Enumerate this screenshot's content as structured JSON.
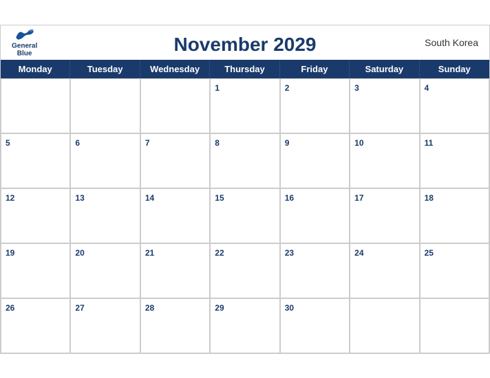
{
  "calendar": {
    "title": "November 2029",
    "country": "South Korea",
    "dayNames": [
      "Monday",
      "Tuesday",
      "Wednesday",
      "Thursday",
      "Friday",
      "Saturday",
      "Sunday"
    ],
    "weeks": [
      [
        {
          "date": "",
          "empty": true
        },
        {
          "date": "",
          "empty": true
        },
        {
          "date": "",
          "empty": true
        },
        {
          "date": "1",
          "empty": false
        },
        {
          "date": "2",
          "empty": false
        },
        {
          "date": "3",
          "empty": false
        },
        {
          "date": "4",
          "empty": false
        }
      ],
      [
        {
          "date": "5",
          "empty": false
        },
        {
          "date": "6",
          "empty": false
        },
        {
          "date": "7",
          "empty": false
        },
        {
          "date": "8",
          "empty": false
        },
        {
          "date": "9",
          "empty": false
        },
        {
          "date": "10",
          "empty": false
        },
        {
          "date": "11",
          "empty": false
        }
      ],
      [
        {
          "date": "12",
          "empty": false
        },
        {
          "date": "13",
          "empty": false
        },
        {
          "date": "14",
          "empty": false
        },
        {
          "date": "15",
          "empty": false
        },
        {
          "date": "16",
          "empty": false
        },
        {
          "date": "17",
          "empty": false
        },
        {
          "date": "18",
          "empty": false
        }
      ],
      [
        {
          "date": "19",
          "empty": false
        },
        {
          "date": "20",
          "empty": false
        },
        {
          "date": "21",
          "empty": false
        },
        {
          "date": "22",
          "empty": false
        },
        {
          "date": "23",
          "empty": false
        },
        {
          "date": "24",
          "empty": false
        },
        {
          "date": "25",
          "empty": false
        }
      ],
      [
        {
          "date": "26",
          "empty": false
        },
        {
          "date": "27",
          "empty": false
        },
        {
          "date": "28",
          "empty": false
        },
        {
          "date": "29",
          "empty": false
        },
        {
          "date": "30",
          "empty": false
        },
        {
          "date": "",
          "empty": true
        },
        {
          "date": "",
          "empty": true
        }
      ]
    ],
    "logo": {
      "line1": "General",
      "line2": "Blue"
    }
  }
}
